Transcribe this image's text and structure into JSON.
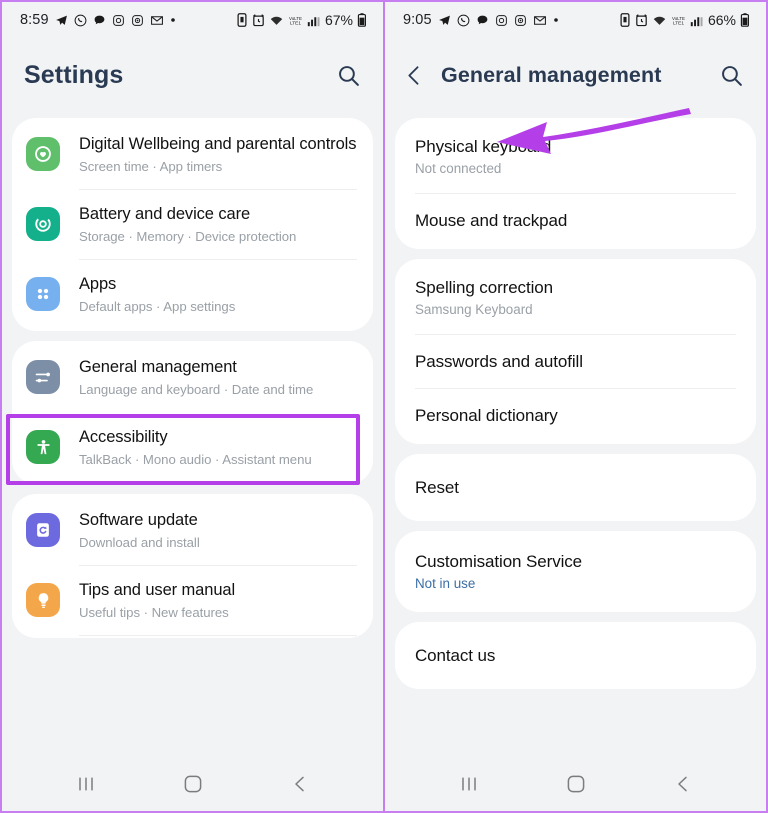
{
  "colors": {
    "accent_purple": "#b43fe8",
    "frame_purple": "#c77ef0",
    "title_navy": "#2a3a52",
    "subtext_grey": "#9aa0a6",
    "link_blue": "#3b6ea5",
    "screen_bg": "#f2f3f5",
    "card_bg": "#ffffff"
  },
  "left_phone": {
    "status_bar": {
      "time": "8:59",
      "icons": [
        "telegram-icon",
        "whatsapp-icon",
        "chat-bubble-icon",
        "instagram-icon",
        "camera-icon",
        "gmail-icon",
        "dot-icon"
      ],
      "right_icons": [
        "sim-icon",
        "alarm-icon",
        "wifi-icon",
        "lte-icon",
        "signal-icon"
      ],
      "battery": "67%"
    },
    "appbar": {
      "title": "Settings",
      "search_icon": "search-icon"
    },
    "groups": [
      {
        "items": [
          {
            "icon": "digital-wellbeing-icon",
            "icon_color": "#5fbf6a",
            "title": "Digital Wellbeing and parental controls",
            "subtitle": "Screen time  ·  App timers"
          },
          {
            "icon": "battery-device-care-icon",
            "icon_color": "#14b08b",
            "title": "Battery and device care",
            "subtitle": "Storage  ·  Memory  ·  Device protection"
          },
          {
            "icon": "apps-icon",
            "icon_color": "#76b0ef",
            "title": "Apps",
            "subtitle": "Default apps  ·  App settings"
          }
        ]
      },
      {
        "items": [
          {
            "icon": "general-management-icon",
            "icon_color": "#7d8fa6",
            "title": "General management",
            "subtitle": "Language and keyboard  ·  Date and time",
            "highlighted": true
          },
          {
            "icon": "accessibility-icon",
            "icon_color": "#35a852",
            "title": "Accessibility",
            "subtitle": "TalkBack  ·  Mono audio  ·  Assistant menu"
          }
        ]
      },
      {
        "items": [
          {
            "icon": "software-update-icon",
            "icon_color": "#6d6ae0",
            "title": "Software update",
            "subtitle": "Download and install"
          },
          {
            "icon": "tips-icon",
            "icon_color": "#f5a council",
            "title": "Tips and user manual",
            "subtitle": "Useful tips  ·  New features"
          }
        ]
      }
    ],
    "navbar": [
      "recents-icon",
      "home-icon",
      "back-icon"
    ]
  },
  "right_phone": {
    "status_bar": {
      "time": "9:05",
      "icons": [
        "telegram-icon",
        "whatsapp-icon",
        "chat-bubble-icon",
        "instagram-icon",
        "camera-icon",
        "gmail-icon",
        "dot-icon"
      ],
      "right_icons": [
        "sim-icon",
        "alarm-icon",
        "wifi-icon",
        "lte-icon",
        "signal-icon"
      ],
      "battery": "66%"
    },
    "appbar": {
      "back_icon": "chevron-left-icon",
      "title": "General management",
      "search_icon": "search-icon"
    },
    "groups": [
      {
        "items": [
          {
            "title": "Physical keyboard",
            "subtitle": "Not connected"
          },
          {
            "title": "Mouse and trackpad"
          }
        ]
      },
      {
        "items": [
          {
            "title": "Spelling correction",
            "subtitle": "Samsung Keyboard"
          },
          {
            "title": "Passwords and autofill"
          },
          {
            "title": "Personal dictionary"
          }
        ]
      },
      {
        "items": [
          {
            "title": "Reset",
            "annotated": true
          }
        ]
      },
      {
        "items": [
          {
            "title": "Customisation Service",
            "subtitle": "Not in use",
            "subtitle_link": true
          }
        ]
      },
      {
        "items": [
          {
            "title": "Contact us"
          }
        ]
      }
    ],
    "navbar": [
      "recents-icon",
      "home-icon",
      "back-icon"
    ]
  }
}
